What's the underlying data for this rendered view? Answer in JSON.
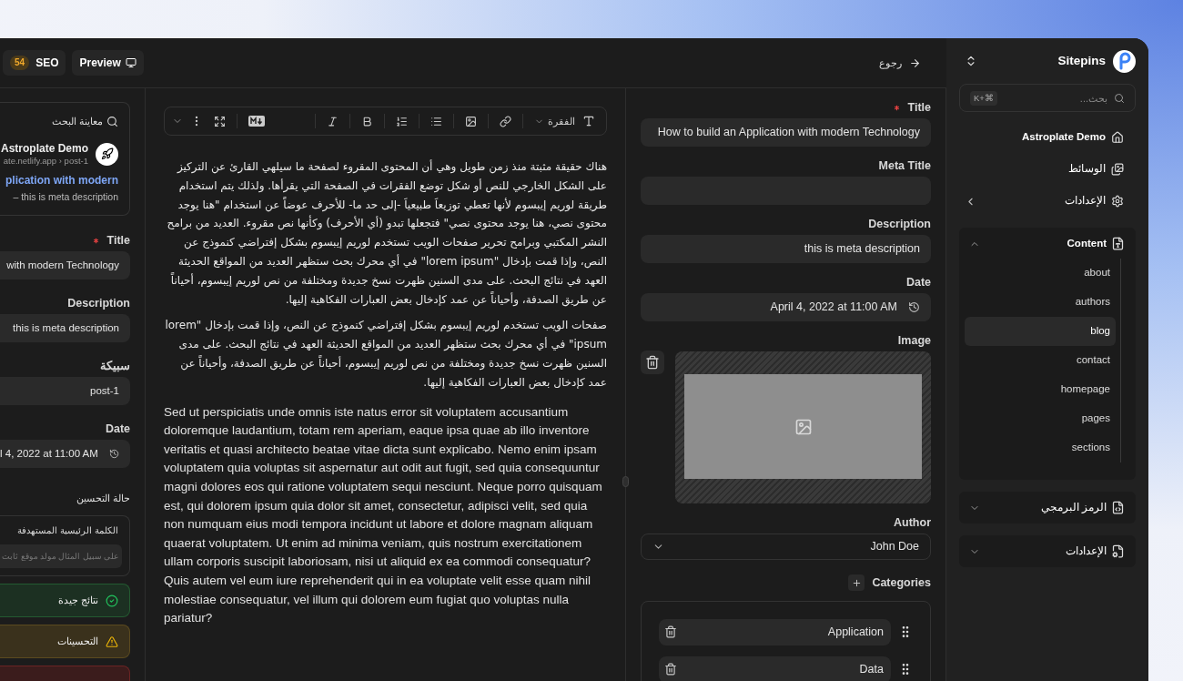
{
  "top_bar": {
    "seo_score": "54",
    "seo_label": "SEO",
    "preview": "Preview",
    "back": "رجوع"
  },
  "seo_panel": {
    "heading": "معاينة البحث",
    "site_name": "Astroplate Demo",
    "url": "ate.netlify.app › post-1",
    "title": "plication with modern",
    "description": "– this is meta description",
    "fields": [
      {
        "kind": "text",
        "label": "Title",
        "required": true,
        "value": "with modern Technology"
      },
      {
        "kind": "text",
        "label": "Description",
        "required": false,
        "value": "this is meta description"
      },
      {
        "kind": "text",
        "label": "سبيكة",
        "required": false,
        "value": "post-1"
      },
      {
        "kind": "date",
        "label": "Date",
        "required": false,
        "value": "l 4, 2022 at 11:00 AM"
      }
    ],
    "optimization": {
      "heading": "حالة التحسين",
      "keyword_label": "الكلمة الرئيسية المستهدفة",
      "keyword_placeholder": "على سبيل المثال مولد موقع ثابت"
    },
    "results": [
      {
        "kind": "good",
        "label": "نتائج جيدة"
      },
      {
        "kind": "warning",
        "label": "التحسينات"
      },
      {
        "kind": "error"
      }
    ]
  },
  "editor": {
    "paragraph_style": "الفقرة",
    "paragraphs": [
      {
        "kind": "arabic",
        "text": "هناك حقيقة مثبتة منذ زمن طويل وهي أن المحتوى المقروء لصفحة ما سيلهي القارئ عن التركيز على الشكل الخارجي للنص أو شكل توضع الفقرات في الصفحة التي يقرأها. ولذلك يتم استخدام طريقة لوريم إيبسوم لأنها تعطي توزيعاَ طبيعياَ -إلى حد ما- للأحرف عوضاً عن استخدام \"هنا يوجد محتوى نصي، هنا يوجد محتوى نصي\" فتجعلها تبدو (أي الأحرف) وكأنها نص مقروء. العديد من برامح النشر المكتبي وبرامح تحرير صفحات الويب تستخدم لوريم إيبسوم بشكل إفتراضي كنموذج عن النص، وإذا قمت بإدخال \"lorem ipsum\" في أي محرك بحث ستظهر العديد من المواقع الحديثة العهد في نتائج البحث. على مدى السنين ظهرت نسخ جديدة ومختلفة من نص لوريم إيبسوم، أحياناً عن طريق الصدفة، وأحياناً عن عمد كإدخال بعض العبارات الفكاهية إليها."
      },
      {
        "kind": "arabic",
        "text": "صفحات الويب تستخدم لوريم إيبسوم بشكل إفتراضي كنموذج عن النص، وإذا قمت بإدخال \"lorem ipsum\" في أي محرك بحث ستظهر العديد من المواقع الحديثة العهد في نتائج البحث. على مدى السنين ظهرت نسخ جديدة ومختلفة من نص لوريم إيبسوم، أحياناً عن طريق الصدفة، وأحياناً عن عمد كإدخال بعض العبارات الفكاهية إليها."
      },
      {
        "kind": "latin",
        "text": "Sed ut perspiciatis unde omnis iste natus error sit voluptatem accusantium doloremque laudantium, totam rem aperiam, eaque ipsa quae ab illo inventore veritatis et quasi architecto beatae vitae dicta sunt explicabo. Nemo enim ipsam voluptatem quia voluptas sit aspernatur aut odit aut fugit, sed quia consequuntur magni dolores eos qui ratione voluptatem sequi nesciunt. Neque porro quisquam est, qui dolorem ipsum quia dolor sit amet, consectetur, adipisci velit, sed quia non numquam eius modi tempora incidunt ut labore et dolore magnam aliquam quaerat voluptatem. Ut enim ad minima veniam, quis nostrum exercitationem ullam corporis suscipit laboriosam, nisi ut aliquid ex ea commodi consequatur? Quis autem vel eum iure reprehenderit qui in ea voluptate velit esse quam nihil molestiae consequatur, vel illum qui dolorem eum fugiat quo voluptas nulla pariatur?"
      }
    ]
  },
  "form": {
    "fields": [
      {
        "kind": "text",
        "label": "Title",
        "required": true,
        "value": "How to build an Application with modern Technology"
      },
      {
        "kind": "text",
        "label": "Meta Title",
        "required": false
      },
      {
        "kind": "text",
        "label": "Description",
        "required": false,
        "value": "this is meta description"
      },
      {
        "kind": "date",
        "label": "Date",
        "required": false,
        "value": "April 4, 2022 at 11:00 AM"
      },
      {
        "kind": "image",
        "label": "Image",
        "required": false
      },
      {
        "kind": "select",
        "label": "Author",
        "required": false,
        "value": "John Doe"
      }
    ],
    "categories": {
      "label": "Categories",
      "items": [
        {
          "label": "Application"
        },
        {
          "label": "Data"
        }
      ]
    }
  },
  "sidebar": {
    "brand": "Sitepins",
    "search_placeholder": "بحث...",
    "shortcut": "K+⌘",
    "items": [
      {
        "kind": "link",
        "label": "Astroplate Demo"
      },
      {
        "kind": "link",
        "label": "الوسائط"
      },
      {
        "kind": "submenu",
        "label": "الإعدادات"
      }
    ],
    "groups": [
      {
        "label": "Content",
        "expanded": true,
        "children": [
          {
            "label": "about",
            "selected": false
          },
          {
            "label": "authors",
            "selected": false
          },
          {
            "label": "blog",
            "selected": true
          },
          {
            "label": "contact",
            "selected": false
          },
          {
            "label": "homepage",
            "selected": false
          },
          {
            "label": "pages",
            "selected": false
          },
          {
            "label": "sections",
            "selected": false
          }
        ]
      },
      {
        "label": "الرمز البرمجي",
        "expanded": false
      },
      {
        "label": "الإعدادات",
        "expanded": false
      }
    ]
  }
}
